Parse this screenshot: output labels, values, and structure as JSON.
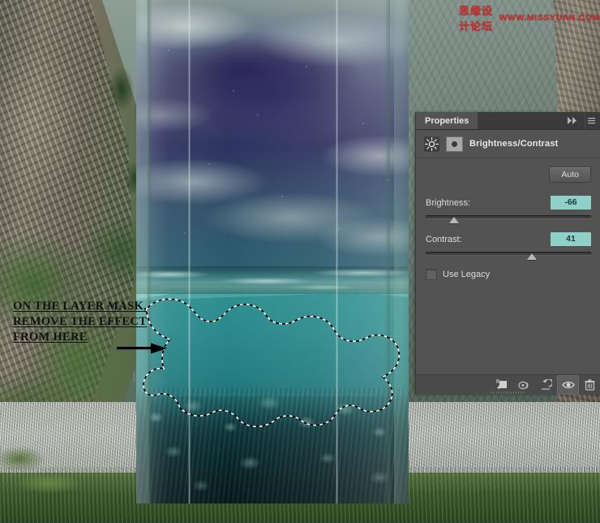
{
  "watermark": {
    "chinese": "思缘设计论坛",
    "url": "WWW.MISSYUAN.COM",
    "color": "#d02a2a"
  },
  "annotation": {
    "line1": "ON THE LAYER MASK,",
    "line2": "REMOVE THE EFFECT",
    "line3": "FROM HERE",
    "arrow_icon": "right-arrow-icon"
  },
  "panel": {
    "tab_label": "Properties",
    "collapse_icon": "double-chevron-right-icon",
    "menu_icon": "panel-menu-icon",
    "adjustment": {
      "icon": "brightness-sun-icon",
      "mask_thumbnail_icon": "layer-mask-thumbnail",
      "title": "Brightness/Contrast"
    },
    "auto_label": "Auto",
    "controls": [
      {
        "label": "Brightness:",
        "value": "-66",
        "percent": 17,
        "min": -150,
        "max": 150
      },
      {
        "label": "Contrast:",
        "value": "41",
        "percent": 64,
        "min": -50,
        "max": 100
      }
    ],
    "use_legacy": {
      "label": "Use Legacy",
      "checked": false
    },
    "footer_buttons": [
      {
        "name": "clip-to-layer-icon",
        "label": "Clip to layer"
      },
      {
        "name": "view-previous-state-icon",
        "label": "View previous state"
      },
      {
        "name": "reset-icon",
        "label": "Reset"
      },
      {
        "name": "toggle-visibility-eye-icon",
        "label": "Toggle layer visibility"
      },
      {
        "name": "delete-trash-icon",
        "label": "Delete adjustment layer"
      }
    ],
    "accent_value_color": "#8fd0c8",
    "panel_bg_color": "#535353"
  },
  "canvas": {
    "description": "Bottle composite with night sky and underwater scene on mountain valley background",
    "selection_label": "marching-ants-selection"
  }
}
